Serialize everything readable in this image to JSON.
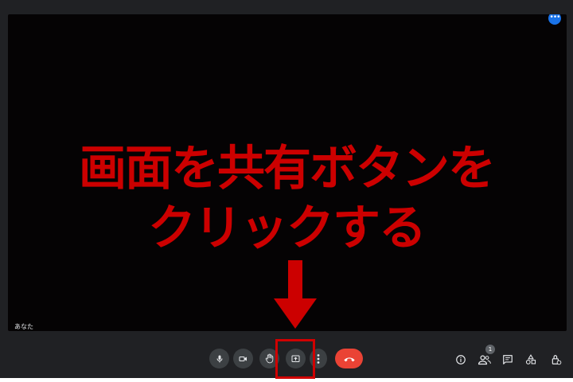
{
  "video": {
    "self_label": "あなた",
    "more_button_glyph": "•••"
  },
  "overlay": {
    "line1": "画面を共有ボタンを",
    "line2": "クリックする",
    "color": "#cc0000"
  },
  "toolbar": {
    "buttons": [
      {
        "icon": "microphone-icon"
      },
      {
        "icon": "camera-icon"
      },
      {
        "icon": "raise-hand-icon"
      },
      {
        "icon": "present-screen-icon"
      },
      {
        "icon": "more-options-icon"
      },
      {
        "icon": "end-call-icon"
      }
    ],
    "right_icons": [
      {
        "icon": "info-icon"
      },
      {
        "icon": "people-icon",
        "badge": "1"
      },
      {
        "icon": "chat-icon"
      },
      {
        "icon": "activities-icon"
      },
      {
        "icon": "host-controls-icon"
      }
    ],
    "end_call_color": "#ea4335"
  }
}
